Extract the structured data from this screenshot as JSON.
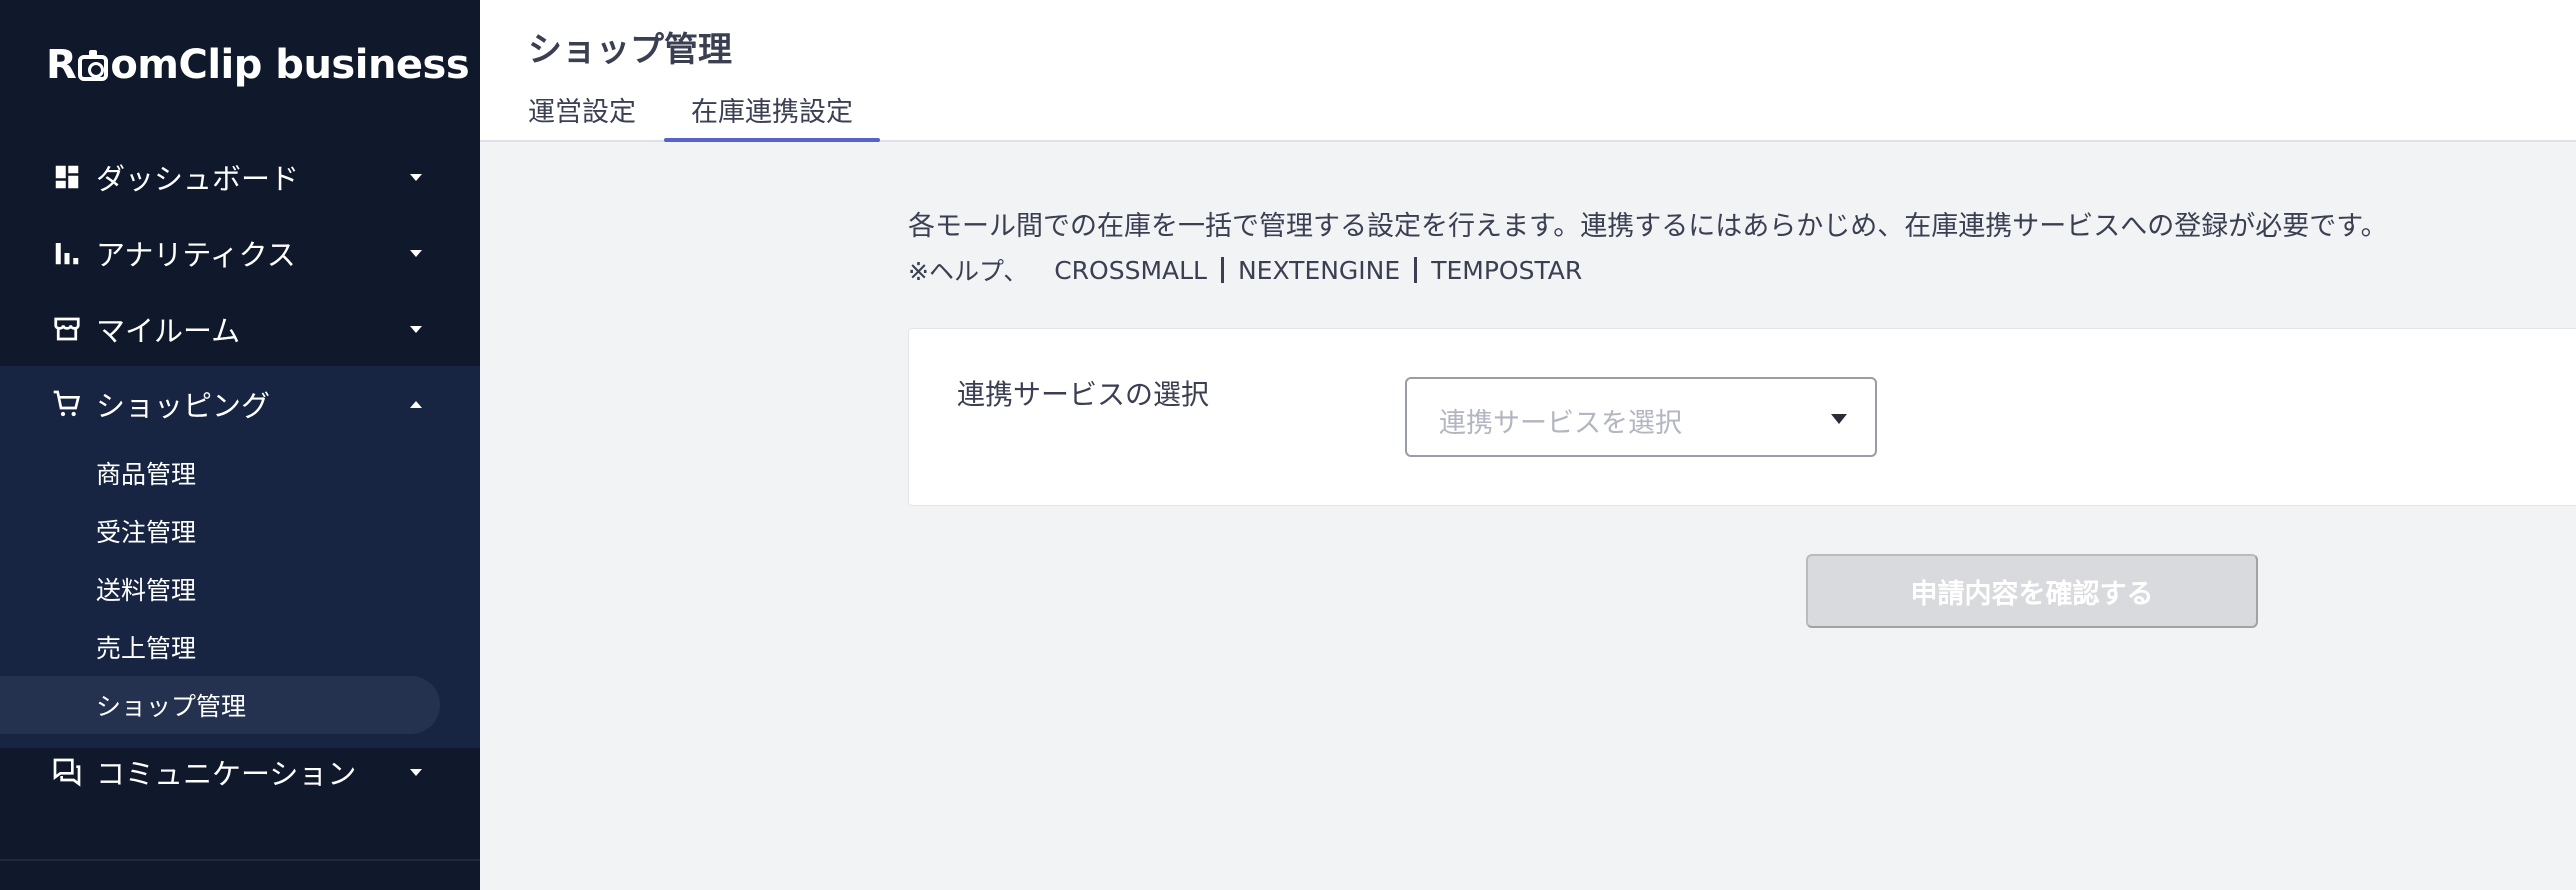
{
  "app": {
    "logo_left": "R",
    "logo_right": "omClip business"
  },
  "sidebar": {
    "items": [
      {
        "label": "ダッシュボード",
        "icon": "dashboard-icon",
        "expanded": false
      },
      {
        "label": "アナリティクス",
        "icon": "analytics-icon",
        "expanded": false
      },
      {
        "label": "マイルーム",
        "icon": "store-icon",
        "expanded": false
      },
      {
        "label": "ショッピング",
        "icon": "cart-icon",
        "expanded": true
      },
      {
        "label": "コミュニケーション",
        "icon": "chat-icon",
        "expanded": false
      }
    ],
    "shopping_sub_items": [
      {
        "label": "商品管理"
      },
      {
        "label": "受注管理"
      },
      {
        "label": "送料管理"
      },
      {
        "label": "売上管理"
      },
      {
        "label": "ショップ管理",
        "active": true
      }
    ]
  },
  "header": {
    "title": "ショップ管理",
    "tabs": [
      {
        "label": "運営設定",
        "active": false
      },
      {
        "label": "在庫連携設定",
        "active": true
      }
    ]
  },
  "main": {
    "description": "各モール間での在庫を一括で管理する設定を行えます。連携するにはあらかじめ、在庫連携サービスへの登録が必要です。",
    "help_prefix": "※ヘルプ、",
    "help_links": [
      "CROSSMALL",
      "NEXTENGINE",
      "TEMPOSTAR"
    ],
    "service_label": "連携サービスの選択",
    "service_select_placeholder": "連携サービスを選択",
    "submit_label": "申請内容を確認する"
  },
  "colors": {
    "sidebar_bg": "#10192b",
    "sidebar_expanded_bg": "#172542",
    "sidebar_active_bg": "#24324f",
    "tab_underline": "#5863c6",
    "disabled_button": "#d9dadd",
    "page_bg": "#f2f3f5"
  }
}
